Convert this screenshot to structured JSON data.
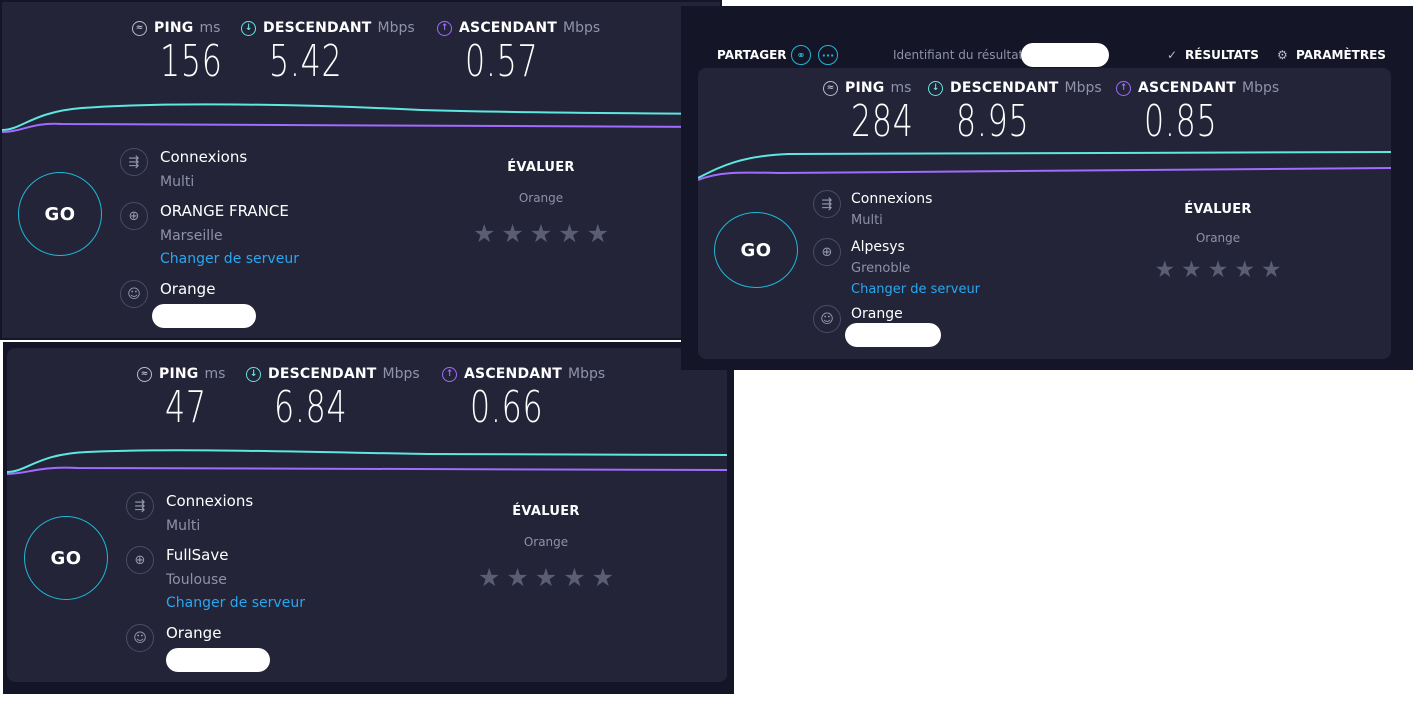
{
  "colors": {
    "download": "#5ee7df",
    "upload": "#a06bff",
    "go_ring": "#1fb7d6",
    "link": "#29a7f0"
  },
  "toolbar": {
    "share_label": "PARTAGER",
    "result_id_label": "Identifiant du résultat",
    "results_label": "RÉSULTATS",
    "settings_label": "PARAMÈTRES"
  },
  "panels": [
    {
      "ping": {
        "label": "PING",
        "unit": "ms",
        "value": "156"
      },
      "download": {
        "label": "DESCENDANT",
        "unit": "Mbps",
        "value": "5.42"
      },
      "upload": {
        "label": "ASCENDANT",
        "unit": "Mbps",
        "value": "0.57"
      },
      "go_label": "GO",
      "connections": {
        "label": "Connexions",
        "value": "Multi"
      },
      "server": {
        "name": "ORANGE FRANCE",
        "city": "Marseille",
        "change_label": "Changer de serveur"
      },
      "isp": {
        "name": "Orange"
      },
      "rate": {
        "title": "ÉVALUER",
        "provider": "Orange",
        "stars": 5
      }
    },
    {
      "ping": {
        "label": "PING",
        "unit": "ms",
        "value": "47"
      },
      "download": {
        "label": "DESCENDANT",
        "unit": "Mbps",
        "value": "6.84"
      },
      "upload": {
        "label": "ASCENDANT",
        "unit": "Mbps",
        "value": "0.66"
      },
      "go_label": "GO",
      "connections": {
        "label": "Connexions",
        "value": "Multi"
      },
      "server": {
        "name": "FullSave",
        "city": "Toulouse",
        "change_label": "Changer de serveur"
      },
      "isp": {
        "name": "Orange"
      },
      "rate": {
        "title": "ÉVALUER",
        "provider": "Orange",
        "stars": 5
      }
    },
    {
      "ping": {
        "label": "PING",
        "unit": "ms",
        "value": "284"
      },
      "download": {
        "label": "DESCENDANT",
        "unit": "Mbps",
        "value": "8.95"
      },
      "upload": {
        "label": "ASCENDANT",
        "unit": "Mbps",
        "value": "0.85"
      },
      "go_label": "GO",
      "connections": {
        "label": "Connexions",
        "value": "Multi"
      },
      "server": {
        "name": "Alpesys",
        "city": "Grenoble",
        "change_label": "Changer de serveur"
      },
      "isp": {
        "name": "Orange"
      },
      "rate": {
        "title": "ÉVALUER",
        "provider": "Orange",
        "stars": 5
      }
    }
  ]
}
